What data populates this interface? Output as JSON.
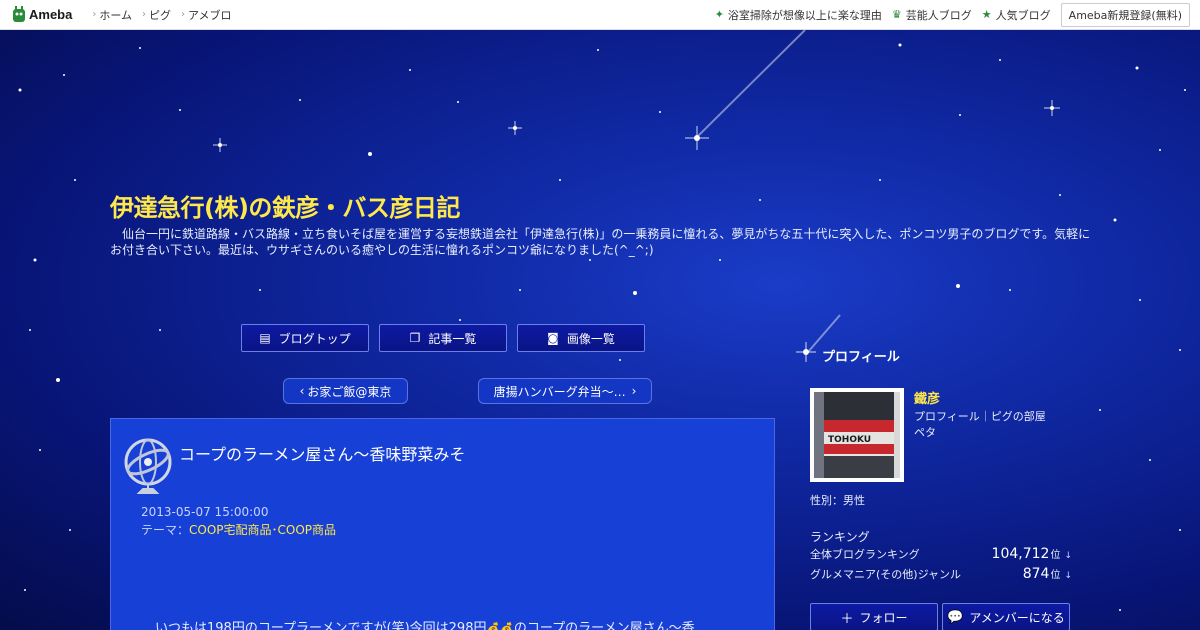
{
  "topbar": {
    "logo": "Ameba",
    "nav_left": [
      "ホーム",
      "ピグ",
      "アメブロ"
    ],
    "nav_right": [
      {
        "label": "浴室掃除が想像以上に楽な理由",
        "icon": "sparkle-icon"
      },
      {
        "label": "芸能人ブログ",
        "icon": "crown-icon"
      },
      {
        "label": "人気ブログ",
        "icon": "star-icon"
      }
    ],
    "register": "Ameba新規登録(無料)"
  },
  "header": {
    "title": "伊達急行(株)の鉄彦・バス彦日記",
    "description": "仙台一円に鉄道路線・バス路線・立ち食いそば屋を運営する妄想鉄道会社「伊達急行(株)」の一乗務員に憧れる、夢見がちな五十代に突入した、ポンコツ男子のブログです。気軽にお付き合い下さい。最近は、ウサギさんのいる癒やしの生活に憧れるポンコツ爺になりました(^_^;)"
  },
  "menu": {
    "blog_top": "ブログトップ",
    "entry_list": "記事一覧",
    "image_list": "画像一覧"
  },
  "pager": {
    "prev": "お家ご飯@東京",
    "next": "唐揚ハンバーグ弁当～…"
  },
  "article": {
    "title": "コープのラーメン屋さん～香味野菜みそ",
    "date": "2013-05-07 15:00:00",
    "theme_label": "テーマ：",
    "theme": "COOP宅配商品･COOP商品",
    "body_start": "いつもは198円のコープラーメンですが(笑)今回は298円",
    "body_end": "のコープのラーメン屋さん～香"
  },
  "sidebar": {
    "profile_heading": "プロフィール",
    "name": "鐵彦",
    "links": [
      "プロフィール",
      "ピグの部屋"
    ],
    "pet": "ペタ",
    "sex": "性別：男性",
    "ranking_heading": "ランキング",
    "rankings": [
      {
        "label": "全体ブログランキング",
        "value": "104,712",
        "unit": "位",
        "arrow": "↓"
      },
      {
        "label": "グルメマニア(その他)ジャンル",
        "value": "874",
        "unit": "位",
        "arrow": "↓"
      }
    ],
    "follow": "フォロー",
    "amember": "アメンバーになる"
  }
}
